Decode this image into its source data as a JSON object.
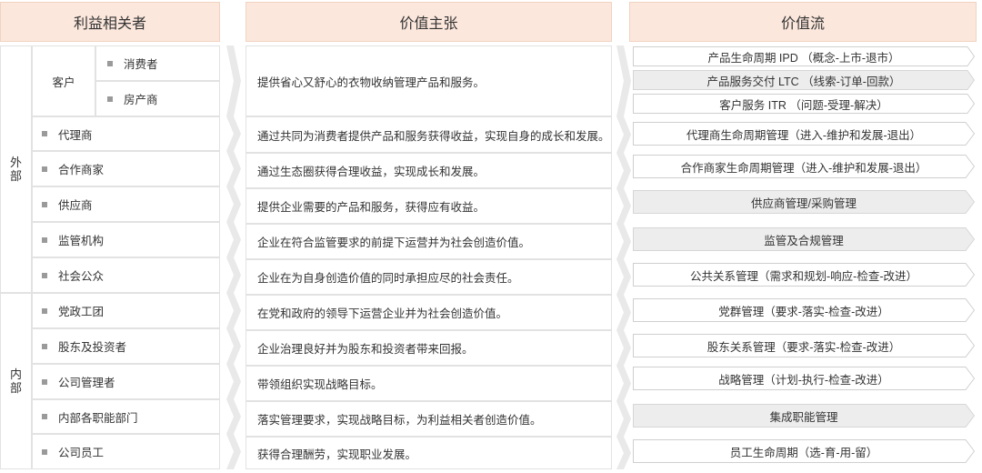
{
  "headers": {
    "stakeholders": "利益相关者",
    "value_proposition": "价值主张",
    "value_stream": "价值流"
  },
  "groups": {
    "external": "外部",
    "internal": "内部"
  },
  "customer": {
    "label": "客户",
    "subs": [
      "消费者",
      "房产商"
    ]
  },
  "stakeholders": [
    "代理商",
    "合作商家",
    "供应商",
    "监管机构",
    "社会公众",
    "党政工团",
    "股东及投资者",
    "公司管理者",
    "内部各职能部门",
    "公司员工"
  ],
  "propositions": [
    "提供省心又舒心的衣物收纳管理产品和服务。",
    "通过共同为消费者提供产品和服务获得收益，实现自身的成长和发展。",
    "通过生态圈获得合理收益，实现成长和发展。",
    "提供企业需要的产品和服务，获得应有收益。",
    "企业在符合监管要求的前提下运营并为社会创造价值。",
    "企业在为自身创造价值的同时承担应尽的社会责任。",
    "在党和政府的领导下运营企业并为社会创造价值。",
    "企业治理良好并为股东和投资者带来回报。",
    "带领组织实现战略目标。",
    "落实管理要求，实现战略目标，为利益相关者创造价值。",
    "获得合理酬劳，实现职业发展。"
  ],
  "value_streams": [
    {
      "label": "产品生命周期 IPD （概念-上市-退市）",
      "style": "outline"
    },
    {
      "label": "产品服务交付 LTC （线索-订单-回款）",
      "style": "filled"
    },
    {
      "label": "客户服务 ITR （问题-受理-解决）",
      "style": "outline"
    },
    {
      "label": "代理商生命周期管理（进入-维护和发展-退出）",
      "style": "outline"
    },
    {
      "label": "合作商家生命周期管理（进入-维护和发展-退出）",
      "style": "outline"
    },
    {
      "label": "供应商管理/采购管理",
      "style": "filled"
    },
    {
      "label": "监管及合规管理",
      "style": "filled"
    },
    {
      "label": "公共关系管理（需求和规划-响应-检查-改进）",
      "style": "outline"
    },
    {
      "label": "党群管理（要求-落实-检查-改进）",
      "style": "outline"
    },
    {
      "label": "股东关系管理（要求-落实-检查-改进）",
      "style": "outline"
    },
    {
      "label": "战略管理（计划-执行-检查-改进）",
      "style": "outline"
    },
    {
      "label": "集成职能管理",
      "style": "filled"
    },
    {
      "label": "员工生命周期（选-育-用-留）",
      "style": "outline"
    }
  ],
  "colors": {
    "header_bg": "#fbe7dc",
    "filled_bg": "#ededed",
    "border": "#e2e2e2",
    "chevron": "#e9e9e9",
    "bullet": "#9a9a9a"
  }
}
